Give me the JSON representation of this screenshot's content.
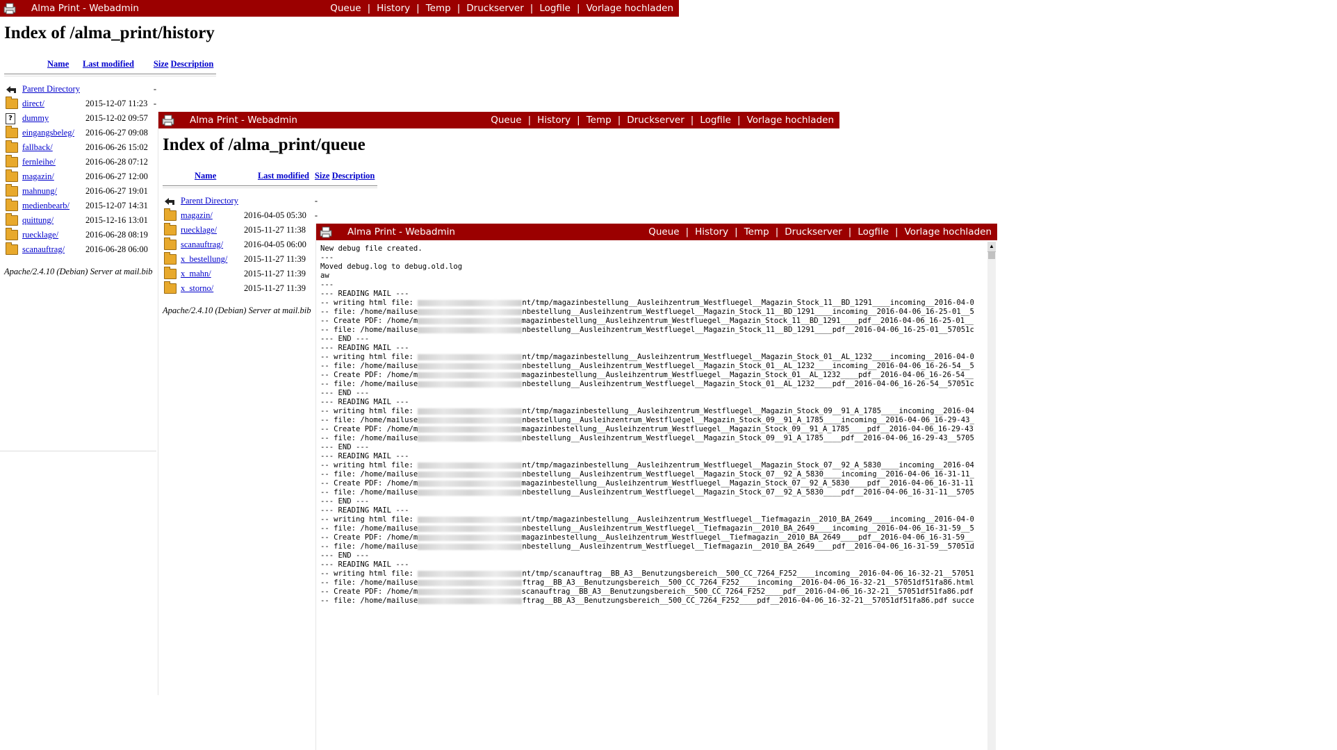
{
  "app_title": "Alma Print - Webadmin",
  "nav": [
    "Queue",
    "History",
    "Temp",
    "Druckserver",
    "Logfile",
    "Vorlage hochladen"
  ],
  "columns": {
    "name": "Name",
    "last_modified": "Last modified",
    "size": "Size",
    "description": "Description"
  },
  "history": {
    "title": "Index of /alma_print/history",
    "parent": {
      "name": "Parent Directory",
      "size": "-"
    },
    "rows": [
      {
        "name": "direct/",
        "modified": "2015-12-07 11:23",
        "size": "-",
        "icon": "folder-icon"
      },
      {
        "name": "dummy",
        "modified": "2015-12-02 09:57",
        "size": "",
        "icon": "unknown-file-icon"
      },
      {
        "name": "eingangsbeleg/",
        "modified": "2016-06-27 09:08",
        "size": "",
        "icon": "folder-icon"
      },
      {
        "name": "fallback/",
        "modified": "2016-06-26 15:02",
        "size": "",
        "icon": "folder-icon"
      },
      {
        "name": "fernleihe/",
        "modified": "2016-06-28 07:12",
        "size": "",
        "icon": "folder-icon"
      },
      {
        "name": "magazin/",
        "modified": "2016-06-27 12:00",
        "size": "",
        "icon": "folder-icon"
      },
      {
        "name": "mahnung/",
        "modified": "2016-06-27 19:01",
        "size": "",
        "icon": "folder-icon"
      },
      {
        "name": "medienbearb/",
        "modified": "2015-12-07 14:31",
        "size": "",
        "icon": "folder-icon"
      },
      {
        "name": "quittung/",
        "modified": "2015-12-16 13:01",
        "size": "",
        "icon": "folder-icon"
      },
      {
        "name": "ruecklage/",
        "modified": "2016-06-28 08:19",
        "size": "",
        "icon": "folder-icon"
      },
      {
        "name": "scanauftrag/",
        "modified": "2016-06-28 06:00",
        "size": "",
        "icon": "folder-icon"
      }
    ],
    "address": "Apache/2.4.10 (Debian) Server at mail.bib"
  },
  "queue": {
    "title": "Index of /alma_print/queue",
    "parent": {
      "name": "Parent Directory",
      "size": "-"
    },
    "rows": [
      {
        "name": "magazin/",
        "modified": "2016-04-05 05:30",
        "size": "-",
        "icon": "folder-icon"
      },
      {
        "name": "ruecklage/",
        "modified": "2015-11-27 11:38",
        "size": "",
        "icon": "folder-icon"
      },
      {
        "name": "scanauftrag/",
        "modified": "2016-04-05 06:00",
        "size": "",
        "icon": "folder-icon"
      },
      {
        "name": "x_bestellung/",
        "modified": "2015-11-27 11:39",
        "size": "",
        "icon": "folder-icon"
      },
      {
        "name": "x_mahn/",
        "modified": "2015-11-27 11:39",
        "size": "",
        "icon": "folder-icon"
      },
      {
        "name": "x_storno/",
        "modified": "2015-11-27 11:39",
        "size": "",
        "icon": "folder-icon"
      }
    ],
    "address": "Apache/2.4.10 (Debian) Server at mail.bib"
  },
  "log": {
    "lines": [
      [
        "New debug file created.",
        "",
        ""
      ],
      [
        "---",
        "",
        ""
      ],
      [
        "Moved debug.log to debug.old.log",
        "",
        ""
      ],
      [
        "aw",
        "",
        ""
      ],
      [
        "---",
        "",
        ""
      ],
      [
        "--- READING MAIL ---",
        "",
        ""
      ],
      [
        "-- writing html file: ",
        "blur",
        "nt/tmp/magazinbestellung__Ausleihzentrum_Westfluegel__Magazin_Stock_11__BD_1291____incoming__2016-04-0"
      ],
      [
        "-- file: /home/mailuse",
        "blur",
        "nbestellung__Ausleihzentrum_Westfluegel__Magazin_Stock_11__BD_1291____incoming__2016-04-06_16-25-01__5"
      ],
      [
        "-- Create PDF: /home/m",
        "blur",
        "magazinbestellung__Ausleihzentrum_Westfluegel__Magazin_Stock_11__BD_1291____pdf__2016-04-06_16-25-01__"
      ],
      [
        "-- file: /home/mailuse",
        "blur",
        "nbestellung__Ausleihzentrum_Westfluegel__Magazin_Stock_11__BD_1291____pdf__2016-04-06_16-25-01__57051c"
      ],
      [
        "--- END ---",
        "",
        ""
      ],
      [
        "--- READING MAIL ---",
        "",
        ""
      ],
      [
        "-- writing html file: ",
        "blur",
        "nt/tmp/magazinbestellung__Ausleihzentrum_Westfluegel__Magazin_Stock_01__AL_1232____incoming__2016-04-0"
      ],
      [
        "-- file: /home/mailuse",
        "blur",
        "nbestellung__Ausleihzentrum_Westfluegel__Magazin_Stock_01__AL_1232____incoming__2016-04-06_16-26-54__5"
      ],
      [
        "-- Create PDF: /home/m",
        "blur",
        "magazinbestellung__Ausleihzentrum_Westfluegel__Magazin_Stock_01__AL_1232____pdf__2016-04-06_16-26-54__"
      ],
      [
        "-- file: /home/mailuse",
        "blur",
        "nbestellung__Ausleihzentrum_Westfluegel__Magazin_Stock_01__AL_1232____pdf__2016-04-06_16-26-54__57051c"
      ],
      [
        "--- END ---",
        "",
        ""
      ],
      [
        "--- READING MAIL ---",
        "",
        ""
      ],
      [
        "-- writing html file: ",
        "blur",
        "nt/tmp/magazinbestellung__Ausleihzentrum_Westfluegel__Magazin_Stock_09__91_A_1785____incoming__2016-04"
      ],
      [
        "-- file: /home/mailuse",
        "blur",
        "nbestellung__Ausleihzentrum_Westfluegel__Magazin_Stock_09__91_A_1785____incoming__2016-04-06_16-29-43_"
      ],
      [
        "-- Create PDF: /home/m",
        "blur",
        "magazinbestellung__Ausleihzentrum_Westfluegel__Magazin_Stock_09__91_A_1785____pdf__2016-04-06_16-29-43"
      ],
      [
        "-- file: /home/mailuse",
        "blur",
        "nbestellung__Ausleihzentrum_Westfluegel__Magazin_Stock_09__91_A_1785____pdf__2016-04-06_16-29-43__5705"
      ],
      [
        "--- END ---",
        "",
        ""
      ],
      [
        "--- READING MAIL ---",
        "",
        ""
      ],
      [
        "-- writing html file: ",
        "blur",
        "nt/tmp/magazinbestellung__Ausleihzentrum_Westfluegel__Magazin_Stock_07__92_A_5830____incoming__2016-04"
      ],
      [
        "-- file: /home/mailuse",
        "blur",
        "nbestellung__Ausleihzentrum_Westfluegel__Magazin_Stock_07__92_A_5830____incoming__2016-04-06_16-31-11_"
      ],
      [
        "-- Create PDF: /home/m",
        "blur",
        "magazinbestellung__Ausleihzentrum_Westfluegel__Magazin_Stock_07__92_A_5830____pdf__2016-04-06_16-31-11"
      ],
      [
        "-- file: /home/mailuse",
        "blur",
        "nbestellung__Ausleihzentrum_Westfluegel__Magazin_Stock_07__92_A_5830____pdf__2016-04-06_16-31-11__5705"
      ],
      [
        "--- END ---",
        "",
        ""
      ],
      [
        "--- READING MAIL ---",
        "",
        ""
      ],
      [
        "-- writing html file: ",
        "blur",
        "nt/tmp/magazinbestellung__Ausleihzentrum_Westfluegel__Tiefmagazin__2010_BA_2649____incoming__2016-04-0"
      ],
      [
        "-- file: /home/mailuse",
        "blur",
        "nbestellung__Ausleihzentrum_Westfluegel__Tiefmagazin__2010_BA_2649____incoming__2016-04-06_16-31-59__5"
      ],
      [
        "-- Create PDF: /home/m",
        "blur",
        "magazinbestellung__Ausleihzentrum_Westfluegel__Tiefmagazin__2010_BA_2649____pdf__2016-04-06_16-31-59__"
      ],
      [
        "-- file: /home/mailuse",
        "blur",
        "nbestellung__Ausleihzentrum_Westfluegel__Tiefmagazin__2010_BA_2649____pdf__2016-04-06_16-31-59__57051d"
      ],
      [
        "--- END ---",
        "",
        ""
      ],
      [
        "--- READING MAIL ---",
        "",
        ""
      ],
      [
        "-- writing html file: ",
        "blur",
        "nt/tmp/scanauftrag__BB_A3__Benutzungsbereich__500_CC_7264_F252____incoming__2016-04-06_16-32-21__57051"
      ],
      [
        "-- file: /home/mailuse",
        "blur",
        "ftrag__BB_A3__Benutzungsbereich__500_CC_7264_F252____incoming__2016-04-06_16-32-21__57051df51fa86.html"
      ],
      [
        "-- Create PDF: /home/m",
        "blur",
        "scanauftrag__BB_A3__Benutzungsbereich__500_CC_7264_F252____pdf__2016-04-06_16-32-21__57051df51fa86.pdf"
      ],
      [
        "-- file: /home/mailuse",
        "blur",
        "ftrag__BB_A3__Benutzungsbereich__500_CC_7264_F252____pdf__2016-04-06_16-32-21__57051df51fa86.pdf succe"
      ]
    ]
  }
}
